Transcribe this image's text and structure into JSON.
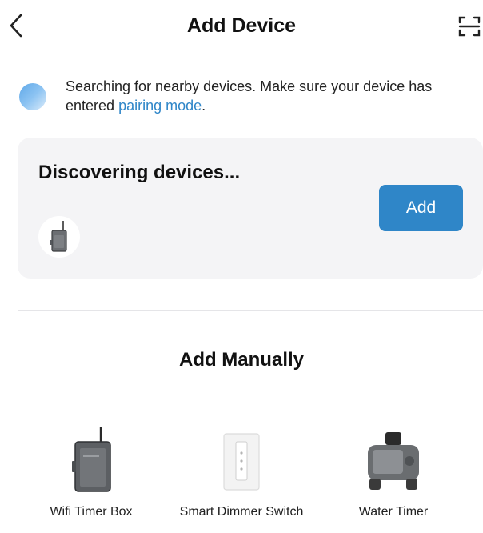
{
  "header": {
    "title": "Add Device",
    "back_icon": "chevron-left-icon",
    "scan_icon": "scan-icon"
  },
  "search": {
    "text": "Searching for nearby devices. Make sure your device has entered ",
    "link": "pairing mode",
    "suffix": "."
  },
  "discover": {
    "title": "Discovering devices...",
    "add_label": "Add",
    "device_icon": "timer-box-icon"
  },
  "manual": {
    "title": "Add Manually",
    "products": [
      {
        "label": "Wifi Timer Box",
        "icon": "timer-box-icon"
      },
      {
        "label": "Smart Dimmer Switch",
        "icon": "dimmer-switch-icon"
      },
      {
        "label": "Water Timer",
        "icon": "water-timer-icon"
      }
    ]
  },
  "colors": {
    "accent": "#2f86c8",
    "card_bg": "#f4f4f6",
    "divider": "#e5e5e8"
  }
}
